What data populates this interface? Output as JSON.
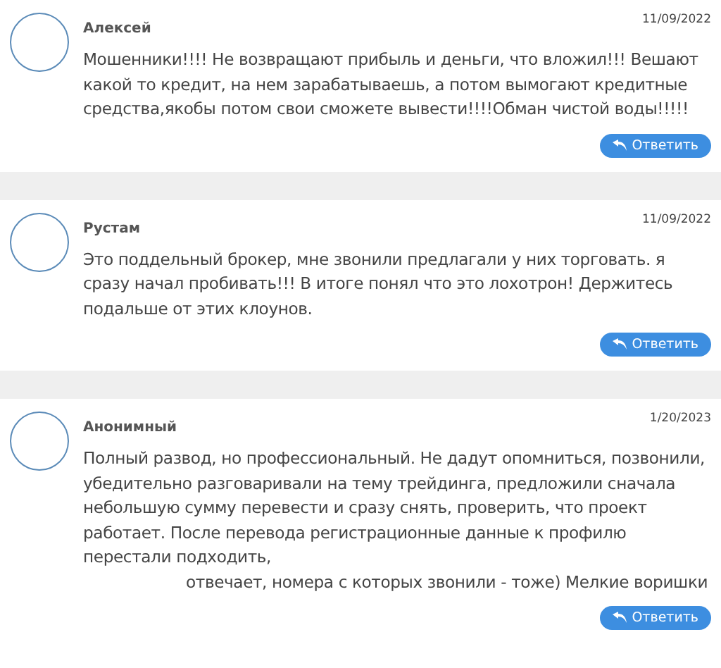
{
  "comments": [
    {
      "author": "Алексей",
      "date": "11/09/2022",
      "text": "Мошенники!!!! Не возвращают прибыль и деньги, что вложил!!! Вешают какой то кредит, на нем зарабатываешь, а потом вымогают кредитные средства,якобы потом свои сможете вывести!!!!Обман чистой воды!!!!!",
      "reply_button": "Ответить"
    },
    {
      "author": "Рустам",
      "date": "11/09/2022",
      "text": "Это поддельный брокер, мне звонили предлагали у них торговать. я сразу начал пробивать!!! В итоге понял что это лохотрон! Держитесь подальше от этих клоунов.",
      "reply_button": "Ответить"
    },
    {
      "author": "Анонимный",
      "date": "1/20/2023",
      "text": "Полный развод, но профессиональный. Не дадут опомниться, позвонили, убедительно разговаривали на тему трейдинга, предложили сначала небольшую сумму перевести и сразу снять, проверить, что проект работает. После перевода регистрационные данные к профилю перестали подходить,",
      "text_continued": "отвечает, номера с которых звонили - тоже) Мелкие воришки",
      "reply_button": "Ответить"
    }
  ]
}
